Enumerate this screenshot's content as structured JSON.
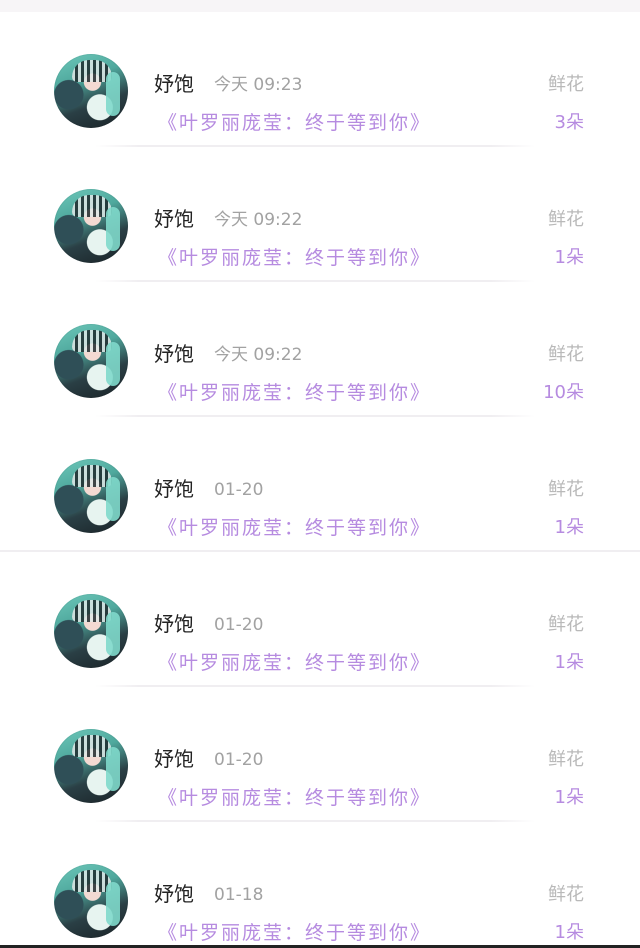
{
  "rows": [
    {
      "name": "妤饱",
      "time": "今天 09:23",
      "title": "《叶罗丽庞莹：终于等到你》",
      "meta_label": "鲜花",
      "meta_count": "3朵"
    },
    {
      "name": "妤饱",
      "time": "今天 09:22",
      "title": "《叶罗丽庞莹：终于等到你》",
      "meta_label": "鲜花",
      "meta_count": "1朵"
    },
    {
      "name": "妤饱",
      "time": "今天 09:22",
      "title": "《叶罗丽庞莹：终于等到你》",
      "meta_label": "鲜花",
      "meta_count": "10朵"
    },
    {
      "name": "妤饱",
      "time": "01-20",
      "title": "《叶罗丽庞莹：终于等到你》",
      "meta_label": "鲜花",
      "meta_count": "1朵"
    },
    {
      "name": "妤饱",
      "time": "01-20",
      "title": "《叶罗丽庞莹：终于等到你》",
      "meta_label": "鲜花",
      "meta_count": "1朵"
    },
    {
      "name": "妤饱",
      "time": "01-20",
      "title": "《叶罗丽庞莹：终于等到你》",
      "meta_label": "鲜花",
      "meta_count": "1朵"
    },
    {
      "name": "妤饱",
      "time": "01-18",
      "title": "《叶罗丽庞莹：终于等到你》",
      "meta_label": "鲜花",
      "meta_count": "1朵"
    }
  ],
  "colors": {
    "accent_purple": "#b68be0",
    "muted_gray": "#a2a2a2",
    "divider": "#f0eef1"
  }
}
